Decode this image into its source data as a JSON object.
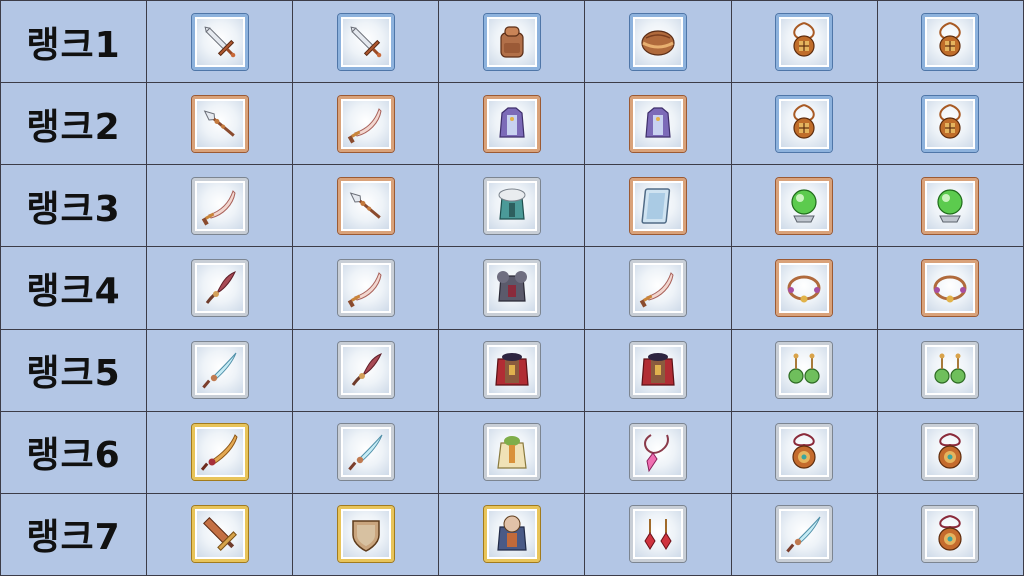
{
  "rows": [
    {
      "label": "랭크1",
      "slots": [
        {
          "icon": "sword-icon",
          "tier": "blue"
        },
        {
          "icon": "sword-icon",
          "tier": "blue"
        },
        {
          "icon": "backpack-icon",
          "tier": "blue"
        },
        {
          "icon": "leather-cap-icon",
          "tier": "blue"
        },
        {
          "icon": "amulet-icon",
          "tier": "blue"
        },
        {
          "icon": "amulet-icon",
          "tier": "blue"
        }
      ]
    },
    {
      "label": "랭크2",
      "slots": [
        {
          "icon": "spear-icon",
          "tier": "copper"
        },
        {
          "icon": "scimitar-icon",
          "tier": "copper"
        },
        {
          "icon": "robe-armor-icon",
          "tier": "copper"
        },
        {
          "icon": "robe-armor-icon",
          "tier": "copper"
        },
        {
          "icon": "amulet-icon",
          "tier": "blue"
        },
        {
          "icon": "amulet-icon",
          "tier": "blue"
        }
      ]
    },
    {
      "label": "랭크3",
      "slots": [
        {
          "icon": "scimitar-icon",
          "tier": "silver"
        },
        {
          "icon": "spear-icon",
          "tier": "copper"
        },
        {
          "icon": "fur-armor-icon",
          "tier": "silver"
        },
        {
          "icon": "shield-icon",
          "tier": "copper"
        },
        {
          "icon": "crystal-orb-icon",
          "tier": "copper"
        },
        {
          "icon": "crystal-orb-icon",
          "tier": "copper"
        }
      ]
    },
    {
      "label": "랭크4",
      "slots": [
        {
          "icon": "curved-blade-icon",
          "tier": "silver"
        },
        {
          "icon": "scimitar-icon",
          "tier": "silver"
        },
        {
          "icon": "dark-armor-icon",
          "tier": "silver"
        },
        {
          "icon": "scimitar-icon",
          "tier": "silver"
        },
        {
          "icon": "bracelet-icon",
          "tier": "copper"
        },
        {
          "icon": "bracelet-icon",
          "tier": "copper"
        }
      ]
    },
    {
      "label": "랭크5",
      "slots": [
        {
          "icon": "ice-blade-icon",
          "tier": "silver"
        },
        {
          "icon": "curved-blade-icon",
          "tier": "silver"
        },
        {
          "icon": "caped-armor-icon",
          "tier": "silver"
        },
        {
          "icon": "caped-armor-icon",
          "tier": "silver"
        },
        {
          "icon": "green-earrings-icon",
          "tier": "silver"
        },
        {
          "icon": "green-earrings-icon",
          "tier": "silver"
        }
      ]
    },
    {
      "label": "랭크6",
      "slots": [
        {
          "icon": "golden-blade-icon",
          "tier": "gold"
        },
        {
          "icon": "ice-blade-icon",
          "tier": "silver"
        },
        {
          "icon": "green-robe-icon",
          "tier": "silver"
        },
        {
          "icon": "pink-pendant-icon",
          "tier": "silver"
        },
        {
          "icon": "medallion-icon",
          "tier": "silver"
        },
        {
          "icon": "medallion-icon",
          "tier": "silver"
        }
      ]
    },
    {
      "label": "랭크7",
      "slots": [
        {
          "icon": "great-sword-icon",
          "tier": "gold"
        },
        {
          "icon": "round-shield-icon",
          "tier": "gold"
        },
        {
          "icon": "hooded-armor-icon",
          "tier": "gold"
        },
        {
          "icon": "ruby-earrings-icon",
          "tier": "silver"
        },
        {
          "icon": "ice-blade-icon",
          "tier": "silver"
        },
        {
          "icon": "medallion-icon",
          "tier": "silver"
        }
      ]
    }
  ]
}
